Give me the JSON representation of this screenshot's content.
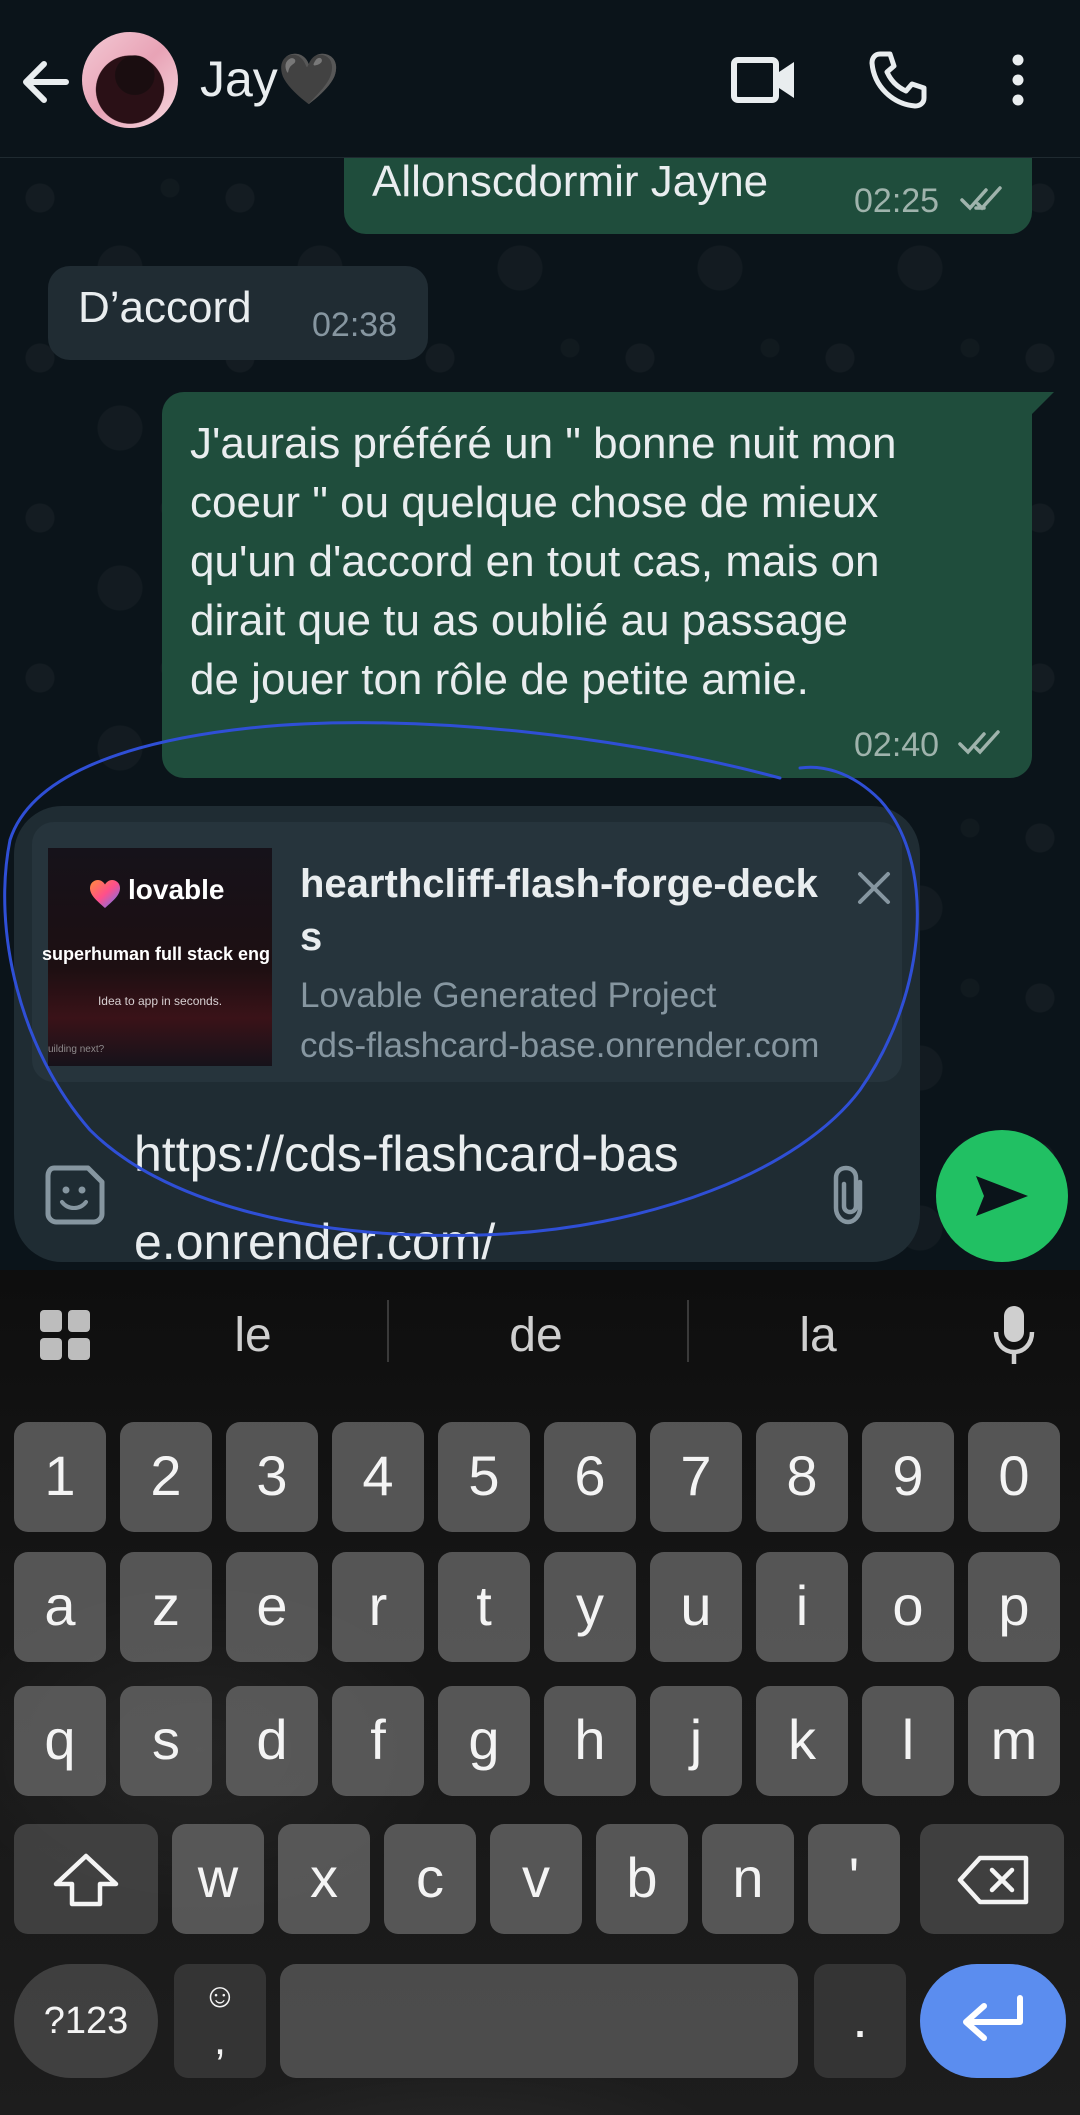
{
  "header": {
    "contact_name": "Jay🖤",
    "icons": [
      "back-arrow-icon",
      "avatar",
      "video-call-icon",
      "voice-call-icon",
      "more-vert-icon"
    ]
  },
  "messages": [
    {
      "direction": "out",
      "text": "Allonscdormir Jayne",
      "time": "02:25",
      "status": "read"
    },
    {
      "direction": "in",
      "text": "D’accord",
      "time": "02:38"
    },
    {
      "direction": "out",
      "text": "J'aurais préféré un \" bonne nuit mon\ncoeur \" ou quelque chose de mieux\nqu'un d'accord en tout cas, mais on\ndirait que tu as oublié au passage\nde jouer ton rôle de petite amie.",
      "time": "02:40",
      "status": "read"
    }
  ],
  "link_preview": {
    "thumb_brand": "lovable",
    "thumb_tagline": "superhuman full stack eng",
    "thumb_sub": "Idea to app in seconds.",
    "thumb_footer": "uilding next?",
    "title": "hearthcliff-flash-forge-decks",
    "description": "Lovable Generated Project",
    "domain": "cds-flashcard-base.onrender.com"
  },
  "composer": {
    "text": "https://cds-flashcard-base.onrender.com/"
  },
  "keyboard": {
    "suggestions": [
      "le",
      "de",
      "la"
    ],
    "row_numbers": [
      "1",
      "2",
      "3",
      "4",
      "5",
      "6",
      "7",
      "8",
      "9",
      "0"
    ],
    "row1": [
      "a",
      "z",
      "e",
      "r",
      "t",
      "y",
      "u",
      "i",
      "o",
      "p"
    ],
    "row2": [
      "q",
      "s",
      "d",
      "f",
      "g",
      "h",
      "j",
      "k",
      "l",
      "m"
    ],
    "row3": [
      "w",
      "x",
      "c",
      "v",
      "b",
      "n",
      "'"
    ],
    "symbols_key": "?123",
    "emoji_key": "☺",
    "comma_key": ",",
    "period_key": "."
  },
  "colors": {
    "outgoing_bubble": "#1f4d3c",
    "incoming_bubble": "#202c33",
    "send_button": "#21c063",
    "enter_key": "#5b8def",
    "annotation_stroke": "#2f4fd6"
  }
}
